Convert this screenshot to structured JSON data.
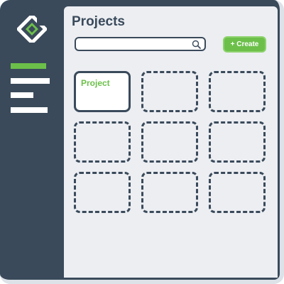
{
  "header": {
    "title": "Projects"
  },
  "search": {
    "value": "",
    "placeholder": ""
  },
  "toolbar": {
    "create_label": "+ Create"
  },
  "sidebar": {
    "logo_icon": "app-logo-icon",
    "menu_icon": "menu-lines-icon",
    "active_item_index": 0,
    "item_count": 4
  },
  "projects": {
    "cards": [
      {
        "label": "Project",
        "state": "filled"
      },
      {
        "label": "",
        "state": "empty"
      },
      {
        "label": "",
        "state": "empty"
      },
      {
        "label": "",
        "state": "empty"
      },
      {
        "label": "",
        "state": "empty"
      },
      {
        "label": "",
        "state": "empty"
      },
      {
        "label": "",
        "state": "empty"
      },
      {
        "label": "",
        "state": "empty"
      },
      {
        "label": "",
        "state": "empty"
      }
    ]
  },
  "colors": {
    "sidebar": "#3a4a5b",
    "accent": "#6cc04a",
    "content_bg": "#eceef2"
  }
}
